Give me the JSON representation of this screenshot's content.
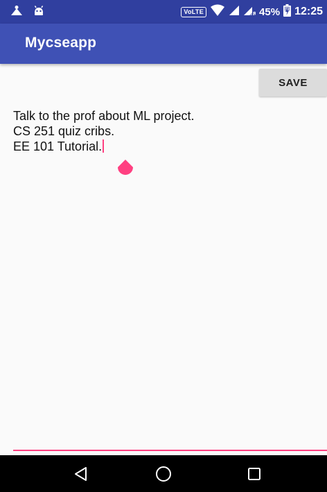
{
  "status_bar": {
    "volte": "VoLTE",
    "battery_percent": "45%",
    "time": "12:25",
    "icons": [
      "android-icon",
      "debug-icon",
      "wifi-icon",
      "signal-icon",
      "signal-r-icon",
      "battery-charging-icon"
    ]
  },
  "app_bar": {
    "title": "Mycseapp"
  },
  "toolbar": {
    "save_label": "SAVE"
  },
  "note": {
    "lines": [
      "Talk to the prof about ML project.",
      "CS 251 quiz cribs.",
      "EE 101 Tutorial."
    ]
  },
  "nav_bar": {
    "icons": [
      "back-icon",
      "home-icon",
      "recents-icon"
    ]
  },
  "colors": {
    "status_bar": "#303f9f",
    "app_bar": "#3f51b5",
    "accent": "#ff4081",
    "background": "#fafafa",
    "button": "#dcdcdc",
    "nav_bar": "#000000"
  }
}
